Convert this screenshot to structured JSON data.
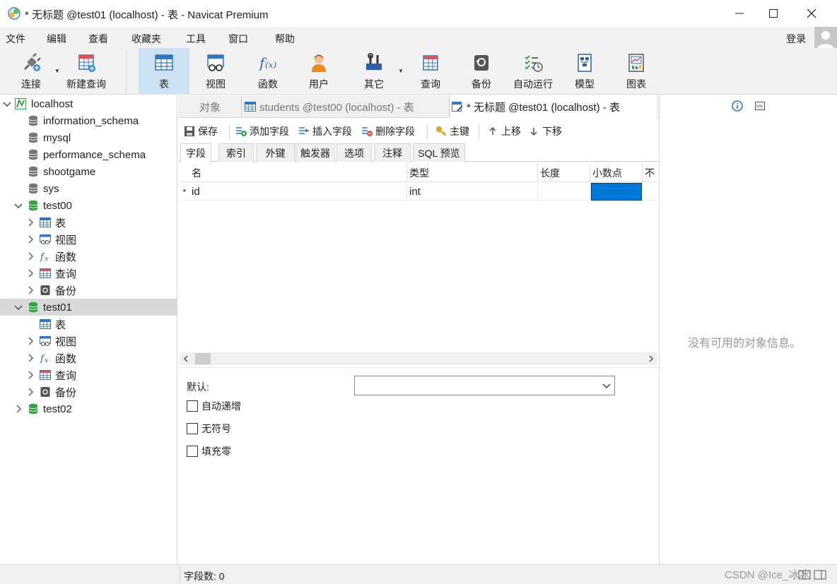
{
  "window": {
    "title": "* 无标题 @test01 (localhost) - 表 - Navicat Premium"
  },
  "menubar": {
    "items": [
      "文件",
      "编辑",
      "查看",
      "收藏夹",
      "工具",
      "窗口",
      "帮助"
    ],
    "login": "登录"
  },
  "toolbar": {
    "items": [
      {
        "label": "连接",
        "icon": "connection-plug-icon"
      },
      {
        "label": "新建查询",
        "icon": "new-query-icon"
      },
      {
        "label": "表",
        "icon": "table-icon",
        "active": true
      },
      {
        "label": "视图",
        "icon": "view-icon"
      },
      {
        "label": "函数",
        "icon": "function-icon"
      },
      {
        "label": "用户",
        "icon": "user-icon"
      },
      {
        "label": "其它",
        "icon": "tools-icon"
      },
      {
        "label": "查询",
        "icon": "query-icon"
      },
      {
        "label": "备份",
        "icon": "backup-icon"
      },
      {
        "label": "自动运行",
        "icon": "schedule-icon"
      },
      {
        "label": "模型",
        "icon": "model-icon"
      },
      {
        "label": "图表",
        "icon": "chart-icon"
      }
    ]
  },
  "nav": {
    "connection": "localhost",
    "databases": [
      {
        "name": "information_schema"
      },
      {
        "name": "mysql"
      },
      {
        "name": "performance_schema"
      },
      {
        "name": "shootgame"
      },
      {
        "name": "sys"
      },
      {
        "name": "test00",
        "children": [
          "表",
          "视图",
          "函数",
          "查询",
          "备份"
        ]
      },
      {
        "name": "test01",
        "children": [
          "表",
          "视图",
          "函数",
          "查询",
          "备份"
        ]
      },
      {
        "name": "test02"
      }
    ]
  },
  "editor": {
    "tabs": [
      {
        "label": "对象"
      },
      {
        "label": "students @test00 (localhost) - 表"
      },
      {
        "label": "* 无标题 @test01 (localhost) - 表"
      }
    ],
    "actions": {
      "save": "保存",
      "add_field": "添加字段",
      "insert_field": "插入字段",
      "delete_field": "删除字段",
      "primary_key": "主键",
      "move_up": "上移",
      "move_down": "下移"
    },
    "subtabs": [
      "字段",
      "索引",
      "外键",
      "触发器",
      "选项",
      "注释",
      "SQL 预览"
    ],
    "grid": {
      "columns": [
        "名",
        "类型",
        "长度",
        "小数点",
        "不"
      ],
      "rows": [
        {
          "marker": "*",
          "name": "id",
          "type": "int",
          "length": "",
          "decimals": ""
        }
      ]
    },
    "props": {
      "default_label": "默认:",
      "default_value": "",
      "auto_increment": "自动递增",
      "unsigned": "无符号",
      "zerofill": "填充零"
    }
  },
  "info_panel": {
    "message": "没有可用的对象信息。"
  },
  "statusbar": {
    "field_count": "字段数: 0",
    "watermark": "CSDN @Ice_冰冰"
  },
  "colors": {
    "accent": "#0078d7",
    "active_tool": "#cde2f4",
    "db_green": "#2fa53b",
    "selected_row": "#d9d9d9"
  }
}
